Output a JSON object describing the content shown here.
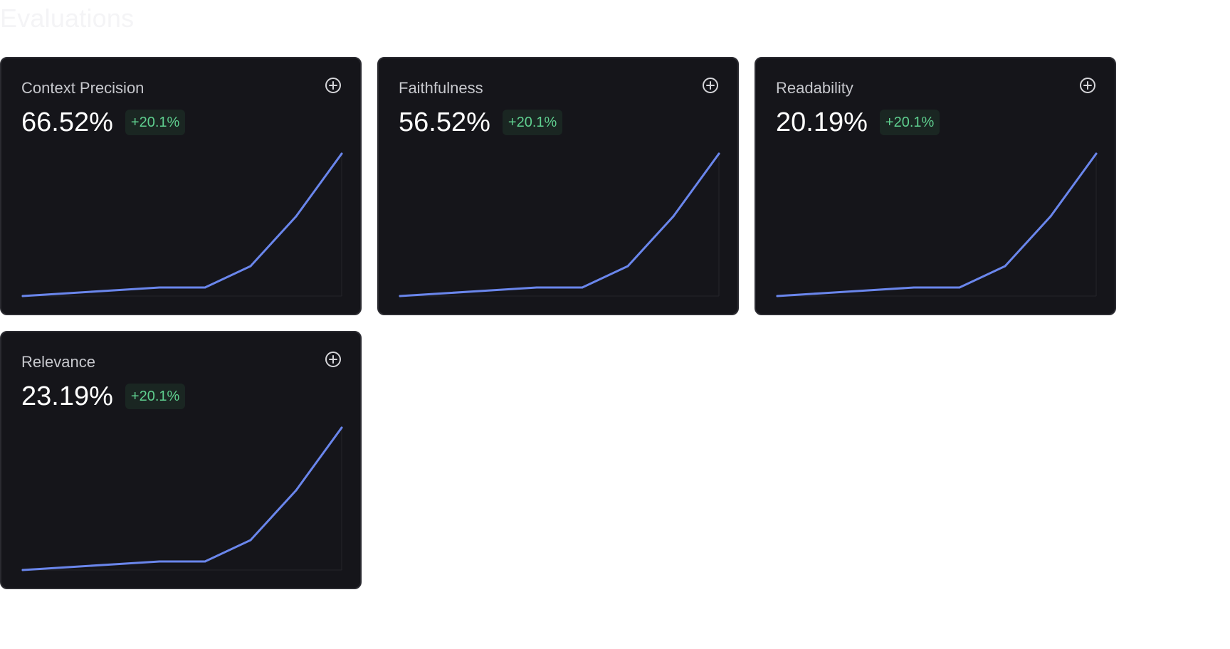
{
  "page": {
    "title": "Evaluations"
  },
  "colors": {
    "card_background": "#15151a",
    "line": "#6a86ec",
    "badge_text": "#5fcf8f",
    "badge_background": "#1a2622"
  },
  "cards": [
    {
      "title": "Context Precision",
      "value": "66.52%",
      "delta": "+20.1%",
      "add_icon": "plus-circle-icon"
    },
    {
      "title": "Faithfulness",
      "value": "56.52%",
      "delta": "+20.1%",
      "add_icon": "plus-circle-icon"
    },
    {
      "title": "Readability",
      "value": "20.19%",
      "delta": "+20.1%",
      "add_icon": "plus-circle-icon"
    },
    {
      "title": "Relevance",
      "value": "23.19%",
      "delta": "+20.1%",
      "add_icon": "plus-circle-icon"
    }
  ],
  "chart_data": [
    {
      "type": "line",
      "x": [
        0,
        1,
        2,
        3,
        4,
        5,
        6,
        7
      ],
      "values": [
        0,
        2,
        4,
        6,
        6,
        21,
        56,
        100
      ],
      "ylim": [
        0,
        100
      ],
      "grid": false
    },
    {
      "type": "line",
      "x": [
        0,
        1,
        2,
        3,
        4,
        5,
        6,
        7
      ],
      "values": [
        0,
        2,
        4,
        6,
        6,
        21,
        56,
        100
      ],
      "ylim": [
        0,
        100
      ],
      "grid": false
    },
    {
      "type": "line",
      "x": [
        0,
        1,
        2,
        3,
        4,
        5,
        6,
        7
      ],
      "values": [
        0,
        2,
        4,
        6,
        6,
        21,
        56,
        100
      ],
      "ylim": [
        0,
        100
      ],
      "grid": false
    },
    {
      "type": "line",
      "x": [
        0,
        1,
        2,
        3,
        4,
        5,
        6,
        7
      ],
      "values": [
        0,
        2,
        4,
        6,
        6,
        21,
        56,
        100
      ],
      "ylim": [
        0,
        100
      ],
      "grid": false
    }
  ]
}
